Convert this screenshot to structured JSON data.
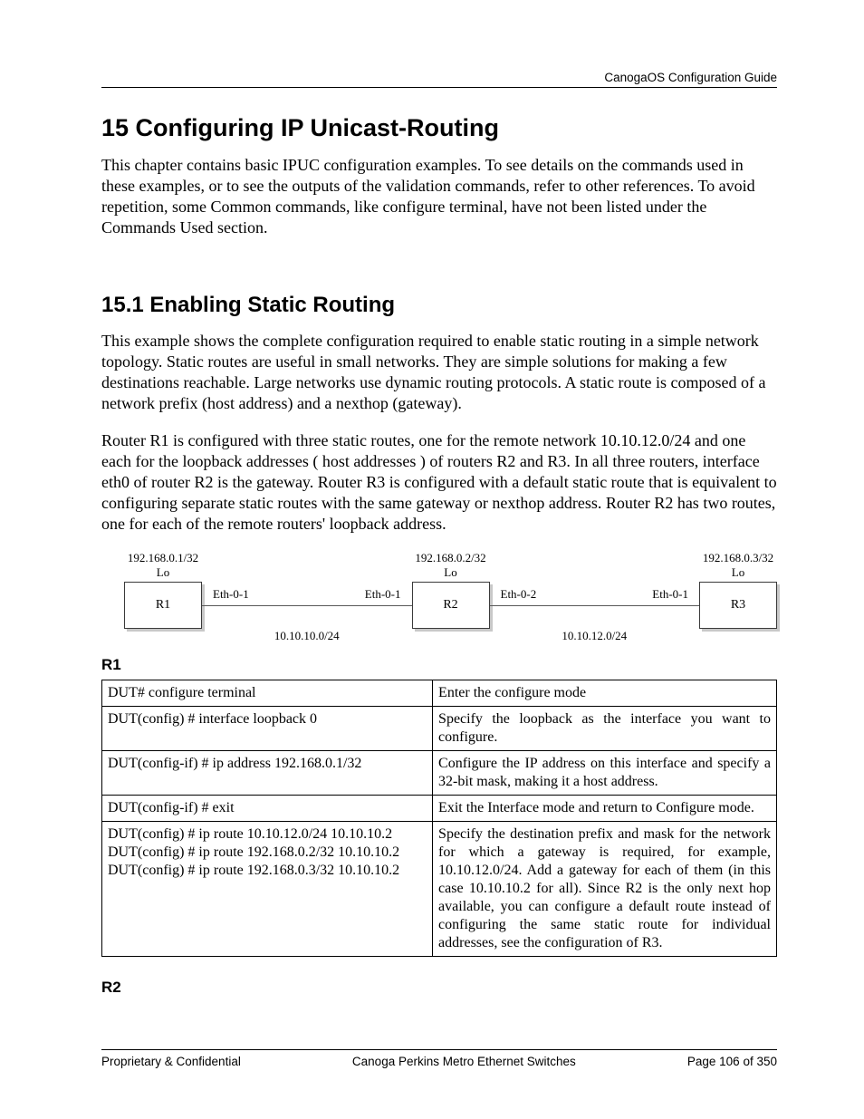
{
  "header": {
    "doc_title": "CanogaOS Configuration Guide"
  },
  "chapter": {
    "number_title": "15 Configuring IP Unicast-Routing",
    "intro": "This chapter contains basic IPUC configuration examples. To see details on the commands used in these examples, or to see the outputs of the validation commands, refer to other references. To avoid repetition, some Common commands, like configure terminal, have not been listed under the Commands Used section."
  },
  "section": {
    "number_title": "15.1  Enabling Static Routing",
    "para1": "This example shows the complete configuration required to enable static routing in a simple network topology. Static routes are useful in small networks. They are simple solutions for making a few destinations reachable. Large networks use dynamic routing protocols. A static route is composed of a network prefix (host address) and a nexthop (gateway).",
    "para2": "Router R1 is configured with three static routes, one for the remote network 10.10.12.0/24 and one each for the loopback addresses   ( host addresses ) of routers R2 and R3. In all three routers, interface eth0 of router R2 is the gateway. Router R3 is configured with a default static route that is equivalent to configuring separate static routes with the same gateway or nexthop address. Router R2 has two routes, one for each of the remote routers' loopback address."
  },
  "diagram": {
    "nodes": [
      {
        "name": "R1",
        "loopback_ip": "192.168.0.1/32",
        "lo_label": "Lo"
      },
      {
        "name": "R2",
        "loopback_ip": "192.168.0.2/32",
        "lo_label": "Lo"
      },
      {
        "name": "R3",
        "loopback_ip": "192.168.0.3/32",
        "lo_label": "Lo"
      }
    ],
    "links": [
      {
        "left_if": "Eth-0-1",
        "right_if": "Eth-0-1",
        "subnet": "10.10.10.0/24"
      },
      {
        "left_if": "Eth-0-2",
        "right_if": "Eth-0-1",
        "subnet": "10.10.12.0/24"
      }
    ]
  },
  "r1": {
    "heading": "R1",
    "rows": [
      {
        "cmd": "DUT# configure terminal",
        "desc": "Enter the configure mode"
      },
      {
        "cmd": "DUT(config) # interface loopback 0",
        "desc": "Specify the loopback as the interface you want to configure."
      },
      {
        "cmd": "DUT(config-if) # ip address 192.168.0.1/32",
        "desc": "Configure the IP address on this interface and specify a 32-bit mask, making it a host address."
      },
      {
        "cmd": "DUT(config-if) # exit",
        "desc": "Exit the Interface mode and return to Configure mode."
      },
      {
        "cmd": "DUT(config) # ip route 10.10.12.0/24 10.10.10.2\nDUT(config) # ip route 192.168.0.2/32 10.10.10.2\nDUT(config) # ip route 192.168.0.3/32 10.10.10.2",
        "desc": "Specify the destination prefix and mask for the network for which a gateway is required, for example, 10.10.12.0/24. Add a gateway for each of them (in this case 10.10.10.2 for all). Since R2 is the only next hop available, you can configure a default route instead of configuring the same static route for individual addresses, see the configuration of R3."
      }
    ]
  },
  "r2": {
    "heading": "R2"
  },
  "footer": {
    "left": "Proprietary & Confidential",
    "center": "Canoga Perkins Metro Ethernet Switches",
    "right": "Page 106 of 350"
  }
}
